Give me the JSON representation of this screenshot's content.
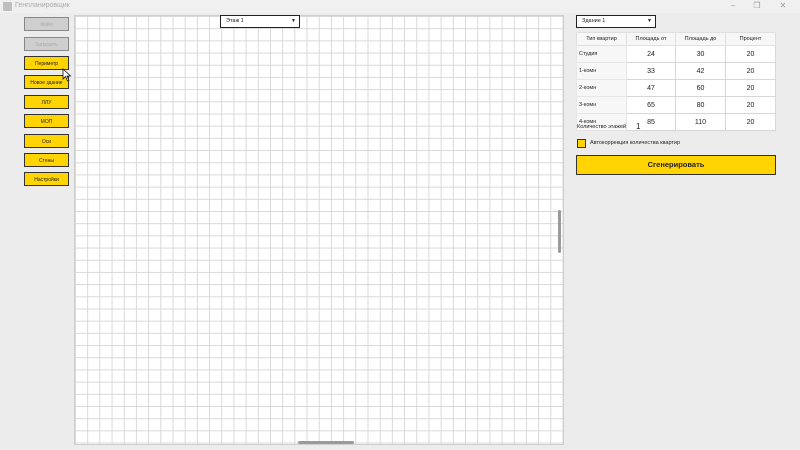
{
  "window": {
    "title": "Генпланировщик",
    "controls": [
      "–",
      "❐",
      "✕"
    ]
  },
  "sidebar": {
    "buttons": [
      {
        "label": "Файл",
        "state": "disabled"
      },
      {
        "label": "Загрузить",
        "state": "disabled"
      },
      {
        "label": "Периметр",
        "state": "active"
      },
      {
        "label": "Новое здание",
        "state": "active"
      },
      {
        "label": "ЛЛУ",
        "state": "active"
      },
      {
        "label": "МОП",
        "state": "active"
      },
      {
        "label": "Оси",
        "state": "active"
      },
      {
        "label": "Стены",
        "state": "active"
      },
      {
        "label": "Настройки",
        "state": "active"
      }
    ]
  },
  "floor_select": {
    "value": "Этаж 1"
  },
  "building_select": {
    "value": "Здание 1"
  },
  "apartment_table": {
    "headers": [
      "Тип квартир",
      "Площадь от",
      "Площадь до",
      "Процент"
    ],
    "rows": [
      {
        "type": "Студия",
        "from": "24",
        "to": "30",
        "percent": "20"
      },
      {
        "type": "1-комн",
        "from": "33",
        "to": "42",
        "percent": "20"
      },
      {
        "type": "2-комн",
        "from": "47",
        "to": "60",
        "percent": "20"
      },
      {
        "type": "3-комн",
        "from": "65",
        "to": "80",
        "percent": "20"
      },
      {
        "type": "4-комн",
        "from": "85",
        "to": "110",
        "percent": "20"
      }
    ]
  },
  "floors": {
    "label": "Количество этажей",
    "value": "1"
  },
  "auto_correct": {
    "label": "Автокоррекция количества квартир",
    "checked": true
  },
  "generate_button": {
    "label": "Сгенерировать"
  },
  "colors": {
    "accent": "#ffd400",
    "background": "#ececec"
  }
}
